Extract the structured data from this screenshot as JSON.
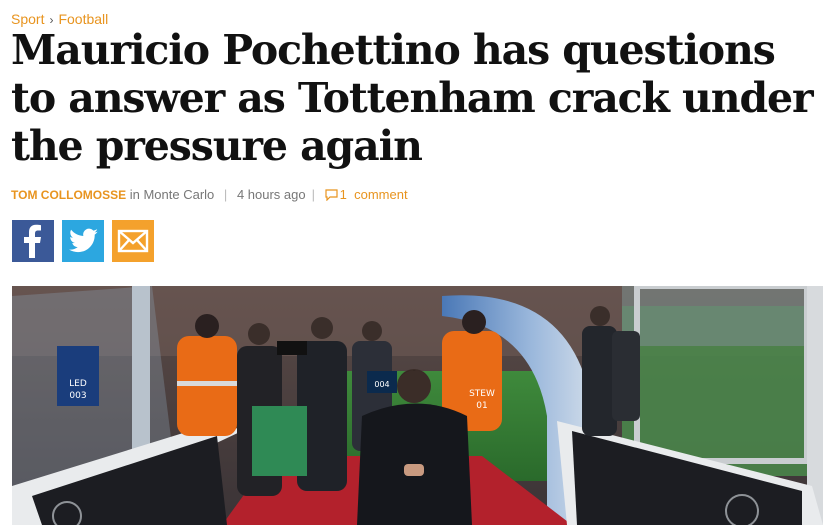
{
  "breadcrumb": {
    "section": "Sport",
    "separator": "›",
    "subsection": "Football"
  },
  "article": {
    "headline": "Mauricio Pochettino has questions to answer as Tottenham crack under the pressure again",
    "author": "TOM COLLOMOSSE",
    "location": "in Monte Carlo",
    "time_ago": "4 hours ago",
    "comment_count": "1",
    "comment_label": "comment"
  },
  "share": {
    "items": [
      "facebook-icon",
      "twitter-icon",
      "email-icon"
    ]
  },
  "colors": {
    "accent": "#e8941f",
    "facebook": "#3b5998",
    "twitter": "#2ca7e0",
    "email": "#f4a12c"
  },
  "photo": {
    "board_text_left": "LED 003",
    "board_text_right": "004",
    "steward_vest": "STEW 01"
  }
}
